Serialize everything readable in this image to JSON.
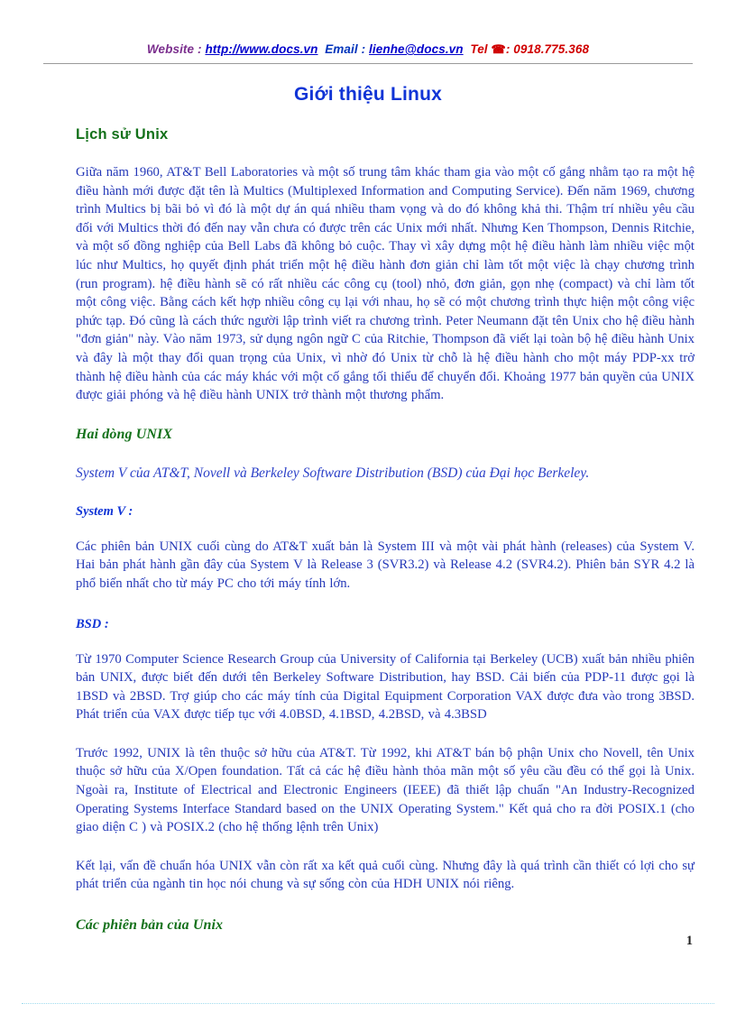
{
  "header": {
    "website_label": "Website",
    "sep1": " : ",
    "website_url": "http://www.docs.vn",
    "email_label": "Email",
    "sep2": " : ",
    "email_address": "lienhe@docs.vn",
    "tel_label": "Tel",
    "phone_icon": "☎",
    "sep3": ": ",
    "phone_number": "0918.775.368"
  },
  "title": "Giới thiệu Linux",
  "sections": {
    "lich_su_unix": {
      "heading": "Lịch sử Unix",
      "paragraph": "Giữa năm 1960, AT&T Bell Laboratories và một số trung tâm khác tham gia vào một cố gắng nhằm tạo ra một hệ điều hành mới được đặt tên là Multics (Multiplexed Information and Computing Service). Đến năm 1969, chương trình Multics bị bãi bỏ vì đó là một dự án quá nhiều tham vọng và do đó không khả thi. Thậm trí nhiều yêu cầu đối với Multics thời đó đến nay vẫn chưa có được trên các Unix mới nhất. Nhưng Ken Thompson, Dennis Ritchie, và một số đồng nghiệp của Bell Labs đã không bỏ cuộc. Thay vì xây dựng một hệ điều hành làm nhiều việc một lúc như Multics, họ quyết định phát triển một hệ điều hành đơn giản chỉ làm tốt một việc là chạy chương trình (run program). hệ điều hành sẽ có rất nhiều các công cụ (tool) nhỏ, đơn giản, gọn nhẹ (compact) và chỉ làm tốt một công việc. Bằng cách kết hợp nhiều công cụ lại với nhau, họ sẽ có một chương trình thực hiện một công việc phức tạp. Đó cũng là cách thức người lập trình viết ra chương trình. Peter Neumann đặt tên Unix cho hệ điều hành \"đơn giản\" này. Vào năm 1973, sử dụng ngôn ngữ C của Ritchie, Thompson đã viết lại toàn bộ hệ điều hành Unix và đây là một thay đổi quan trọng của Unix, vì nhờ đó Unix từ chỗ là hệ điều hành cho một máy PDP-xx trở thành hệ điều hành của các máy khác với một cố gắng tối thiểu để chuyển đổi. Khoảng 1977 bản quyền của UNIX được giải phóng và hệ điều hành UNIX trở thành một thương phẩm."
    },
    "hai_dong_unix": {
      "heading": "Hai dòng UNIX",
      "lead": "System V của AT&T, Novell và Berkeley Software Distribution (BSD) của Đại học Berkeley.",
      "system_v": {
        "label": "System V :",
        "paragraph": "Các phiên bản UNIX cuối cùng do AT&T xuất bản là System III và một vài phát hành (releases) của System V. Hai bản phát hành gần đây của System V là Release 3 (SVR3.2) và Release 4.2 (SVR4.2). Phiên bản SYR 4.2 là phổ biến nhất cho từ máy PC cho tới máy tính lớn."
      },
      "bsd": {
        "label": "BSD :",
        "paragraph_1": "Từ 1970 Computer Science Research Group của University of California tại Berkeley (UCB) xuất bản nhiều phiên bản UNIX, được biết đến dưới tên Berkeley Software Distribution, hay BSD. Cải biến của PDP-11 được gọi là 1BSD và 2BSD. Trợ giúp cho các máy tính của Digital Equipment Corporation VAX được đưa vào trong 3BSD. Phát triển của VAX được tiếp tục với 4.0BSD, 4.1BSD, 4.2BSD, và 4.3BSD",
        "paragraph_2": "Trước 1992, UNIX là tên thuộc sở hữu của AT&T. Từ 1992, khi AT&T bán bộ phận Unix cho Novell, tên Unix thuộc sở hữu của X/Open foundation. Tất cả các hệ điều hành thỏa mãn một số yêu cầu đều có thể gọi là Unix. Ngoài ra, Institute of Electrical and Electronic Engineers (IEEE) đã thiết lập chuẩn \"An Industry-Recognized Operating Systems Interface Standard based on the UNIX Operating System.\" Kết quả cho ra đời POSIX.1 (cho giao diện C ) và POSIX.2 (cho hệ thống lệnh trên Unix)",
        "paragraph_3": "Kết lại, vấn đề chuẩn hóa UNIX vẫn còn rất xa kết quả cuối cùng. Nhưng đây là quá trình cần thiết có lợi cho sự phát triển của ngành tin học nói chung và sự sống còn của HDH UNIX nói riêng."
      }
    },
    "cac_phien_ban": {
      "heading": "Các phiên bản của Unix"
    }
  },
  "footer": {
    "page_number": "1"
  },
  "colors": {
    "title_blue": "#1034D6",
    "heading_green": "#14711B",
    "body_blue": "#2438B8",
    "header_purple": "#7B2F8E",
    "header_red": "#D00000",
    "link_blue": "#0000CC"
  }
}
